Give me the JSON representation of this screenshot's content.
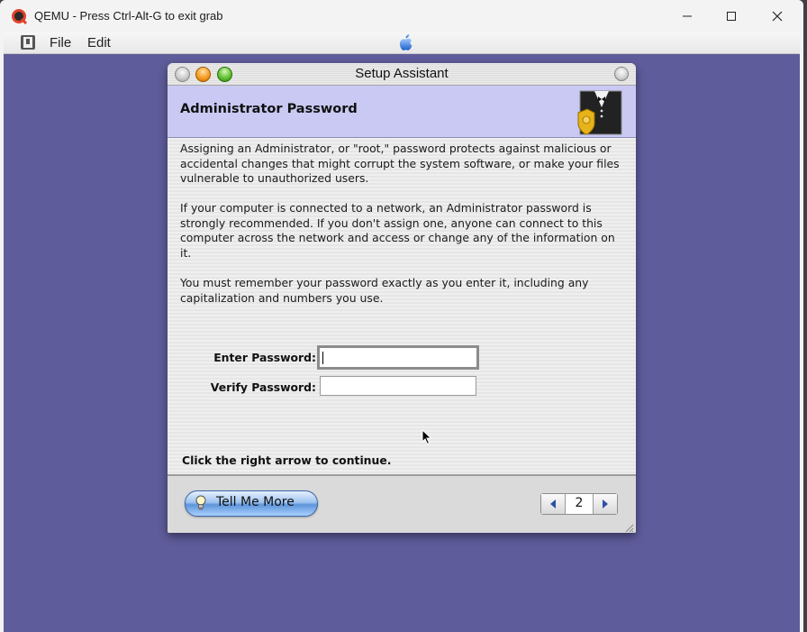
{
  "host": {
    "title": "QEMU - Press Ctrl-Alt-G to exit grab",
    "menu": [
      "File",
      "Edit"
    ],
    "window_controls": [
      "minimize-icon",
      "maximize-icon",
      "close-icon"
    ]
  },
  "guest": {
    "background_color": "#5f5c9b",
    "menubar_icon": "apple-icon"
  },
  "setup_assistant": {
    "window_title": "Setup Assistant",
    "heading": "Administrator Password",
    "header_icon": "tuxedo-badge-icon",
    "paragraphs": [
      "Assigning an Administrator, or \"root,\" password protects against malicious or accidental changes that might corrupt the system software, or make your files vulnerable to unauthorized users.",
      "If your computer is connected to a network, an Administrator password is strongly recommended.  If you don't assign one, anyone can connect to this computer across the network and access or change any of the information on it.",
      "You must remember your password exactly as you enter it, including any capitalization and numbers you use."
    ],
    "enter_password_label": "Enter Password:",
    "enter_password_value": "",
    "verify_password_label": "Verify Password:",
    "verify_password_value": "",
    "continue_text": "Click the right arrow to continue.",
    "tell_me_more_label": "Tell Me More",
    "page_number": "2"
  }
}
